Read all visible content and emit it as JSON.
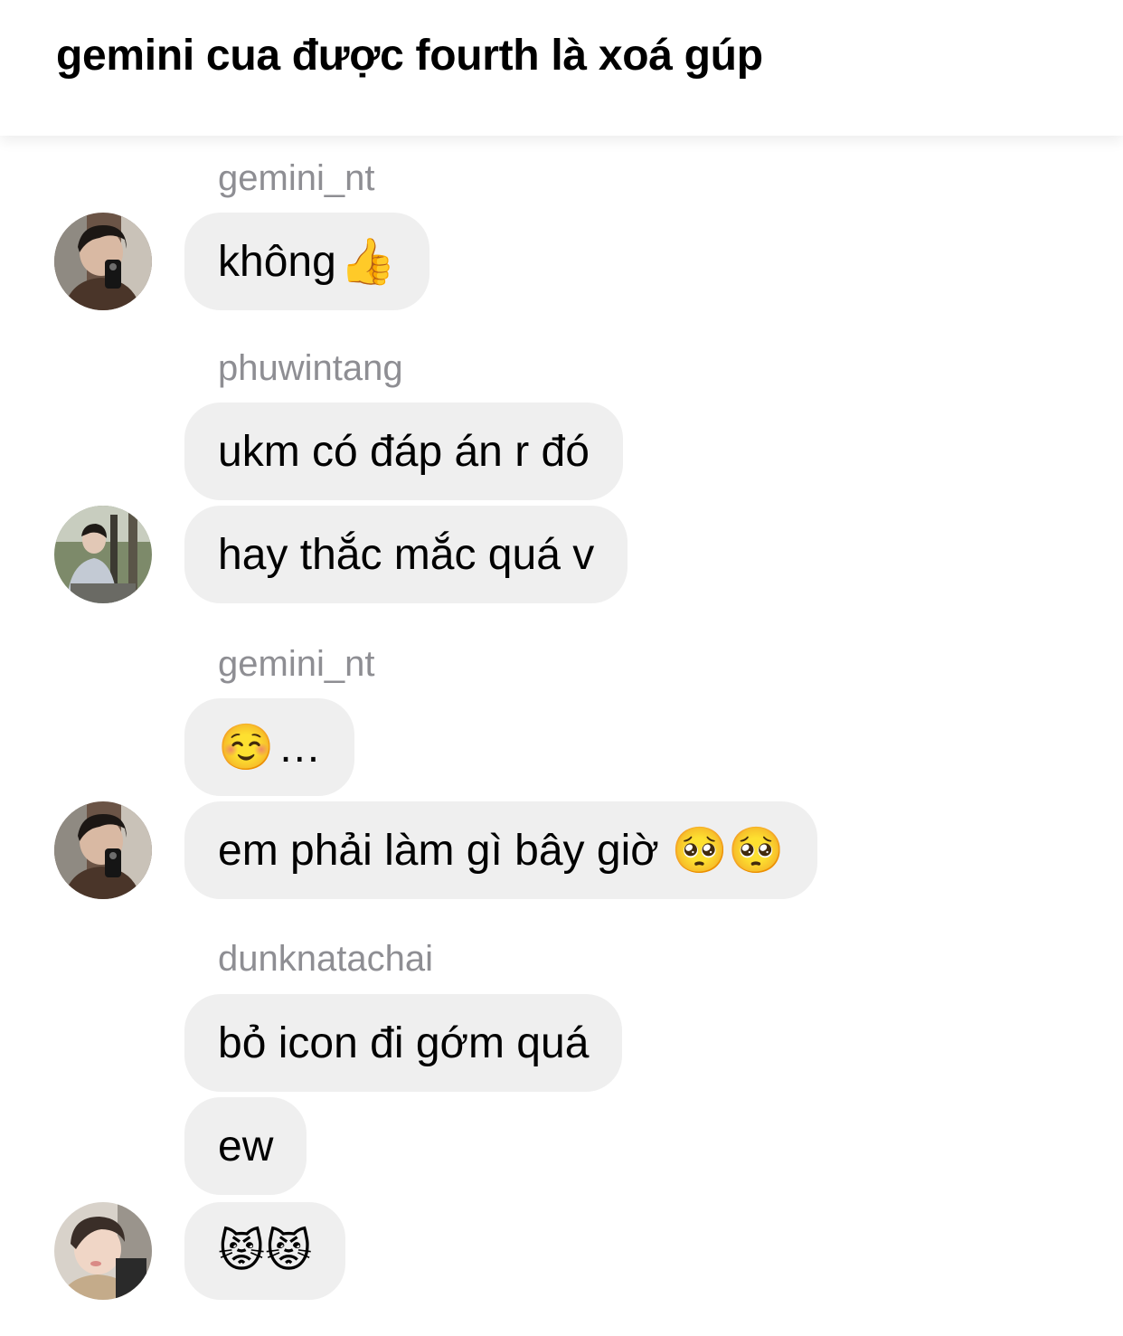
{
  "header": {
    "title": "gemini cua được fourth là xoá gúp"
  },
  "messages": [
    {
      "sender": "gemini_nt",
      "bubbles": [
        {
          "text": "không",
          "emoji": "👍"
        }
      ]
    },
    {
      "sender": "phuwintang",
      "bubbles": [
        {
          "text": "ukm có đáp án r đó"
        },
        {
          "text": "hay thắc mắc quá v"
        }
      ]
    },
    {
      "sender": "gemini_nt",
      "bubbles": [
        {
          "text": "…",
          "emoji_before": "☺️"
        },
        {
          "text": "em phải làm gì bây giờ",
          "emoji": "🥺🥺"
        }
      ]
    },
    {
      "sender": "dunknatachai",
      "bubbles": [
        {
          "text": "bỏ icon đi gớm quá"
        },
        {
          "text": "ew"
        },
        {
          "text": "",
          "emoji": "😾😾"
        }
      ]
    }
  ],
  "icons": {
    "avatar_gemini": "profile-photo-avatar",
    "avatar_phuwin": "profile-photo-avatar",
    "avatar_dunk": "profile-photo-avatar"
  },
  "colors": {
    "bubble": "#efefef",
    "sender_text": "#8e8e93"
  }
}
